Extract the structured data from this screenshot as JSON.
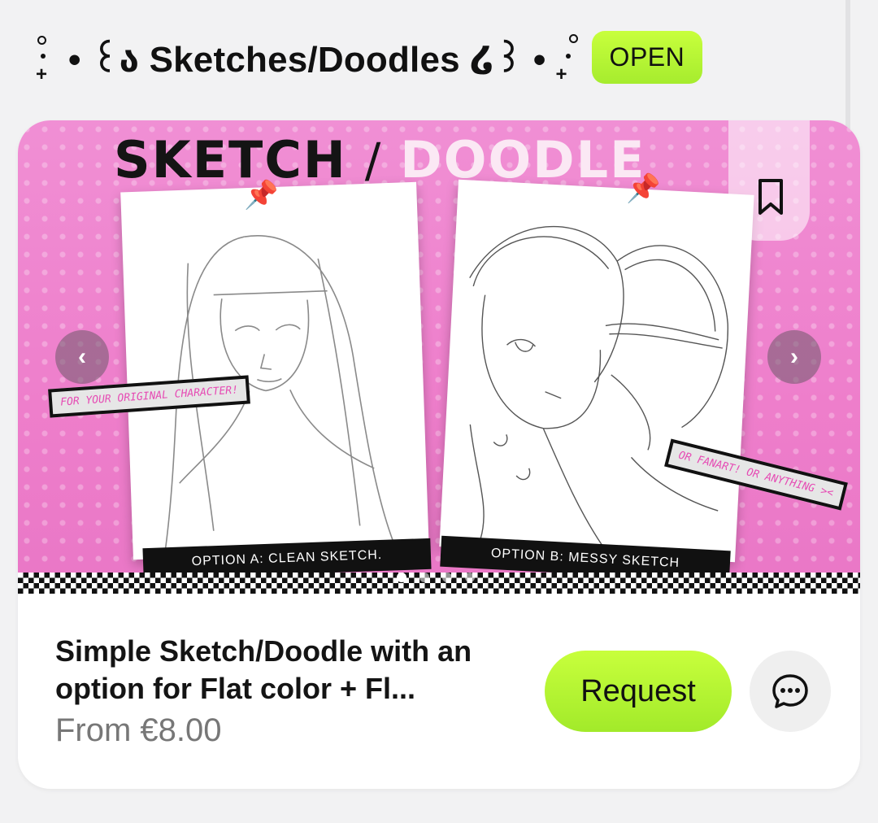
{
  "header": {
    "title": "• ꒰ა Sketches/Doodles ໒꒱ •",
    "status_badge": "OPEN"
  },
  "banner": {
    "title_left": "SKETCH",
    "title_slash": "/",
    "title_right": "DOODLE",
    "option_a": "OPTION A: CLEAN SKETCH.",
    "option_b": "OPTION B: MESSY SKETCH",
    "tag_a": "FOR YOUR ORIGINAL CHARACTER!",
    "tag_b": "OR FANART! OR ANYTHING ><",
    "prev_glyph": "‹",
    "next_glyph": "›",
    "pin_glyph": "📌",
    "carousel_active_index": 0,
    "carousel_count": 4
  },
  "product": {
    "title": "Simple Sketch/Doodle with an option for Flat color + Fl...",
    "price": "From €8.00",
    "request_label": "Request"
  },
  "icons": {
    "bookmark": "bookmark-icon",
    "chat": "chat-bubble-icon",
    "prev": "chevron-left-icon",
    "next": "chevron-right-icon"
  },
  "colors": {
    "accent_green": "#b6f23a",
    "banner_pink": "#ee7ecb",
    "tag_pink": "#e64bb4"
  }
}
